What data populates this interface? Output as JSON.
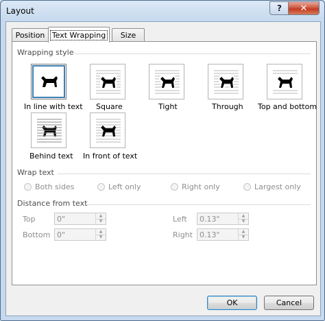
{
  "window": {
    "title": "Layout",
    "help_label": "?",
    "close_label": "✕"
  },
  "tabs": [
    {
      "label": "Position"
    },
    {
      "label": "Text Wrapping"
    },
    {
      "label": "Size"
    }
  ],
  "wrapping_style": {
    "heading": "Wrapping style",
    "selected": "in-line",
    "options": [
      {
        "label": "In line with text"
      },
      {
        "label": "Square"
      },
      {
        "label": "Tight"
      },
      {
        "label": "Through"
      },
      {
        "label": "Top and bottom"
      },
      {
        "label": "Behind text"
      },
      {
        "label": "In front of text"
      }
    ]
  },
  "wrap_text": {
    "heading": "Wrap text",
    "options": [
      {
        "label": "Both sides"
      },
      {
        "label": "Left only"
      },
      {
        "label": "Right only"
      },
      {
        "label": "Largest only"
      }
    ]
  },
  "distance": {
    "heading": "Distance from text",
    "top": {
      "label": "Top",
      "value": "0\""
    },
    "bottom": {
      "label": "Bottom",
      "value": "0\""
    },
    "left": {
      "label": "Left",
      "value": "0.13\""
    },
    "right": {
      "label": "Right",
      "value": "0.13\""
    }
  },
  "buttons": {
    "ok": "OK",
    "cancel": "Cancel"
  },
  "colors": {
    "selection": "#3c7fb1",
    "disabled_text": "#8d8d8d"
  }
}
